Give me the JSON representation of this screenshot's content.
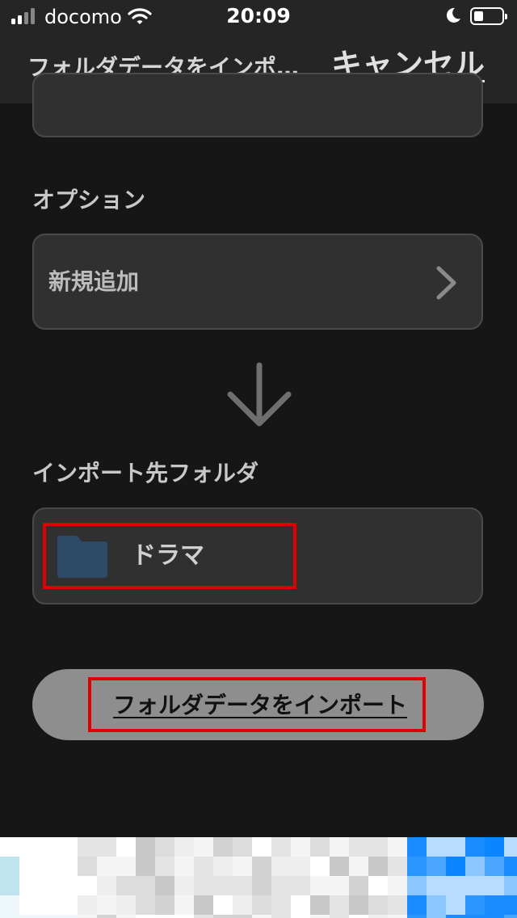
{
  "status_bar": {
    "carrier": "docomo",
    "time": "20:09",
    "battery_level": 0.35
  },
  "nav": {
    "title": "フォルダデータをインポ…",
    "cancel_label": "キャンセル"
  },
  "options": {
    "section_label": "オプション",
    "selected_value": "新規追加"
  },
  "destination": {
    "section_label": "インポート先フォルダ",
    "folder_name": "ドラマ",
    "folder_color": "#2e4a66"
  },
  "actions": {
    "import_label": "フォルダデータをインポート"
  },
  "colors": {
    "background": "#161616",
    "card": "#303030",
    "highlight": "#e00000",
    "button": "#8e8e8e"
  }
}
